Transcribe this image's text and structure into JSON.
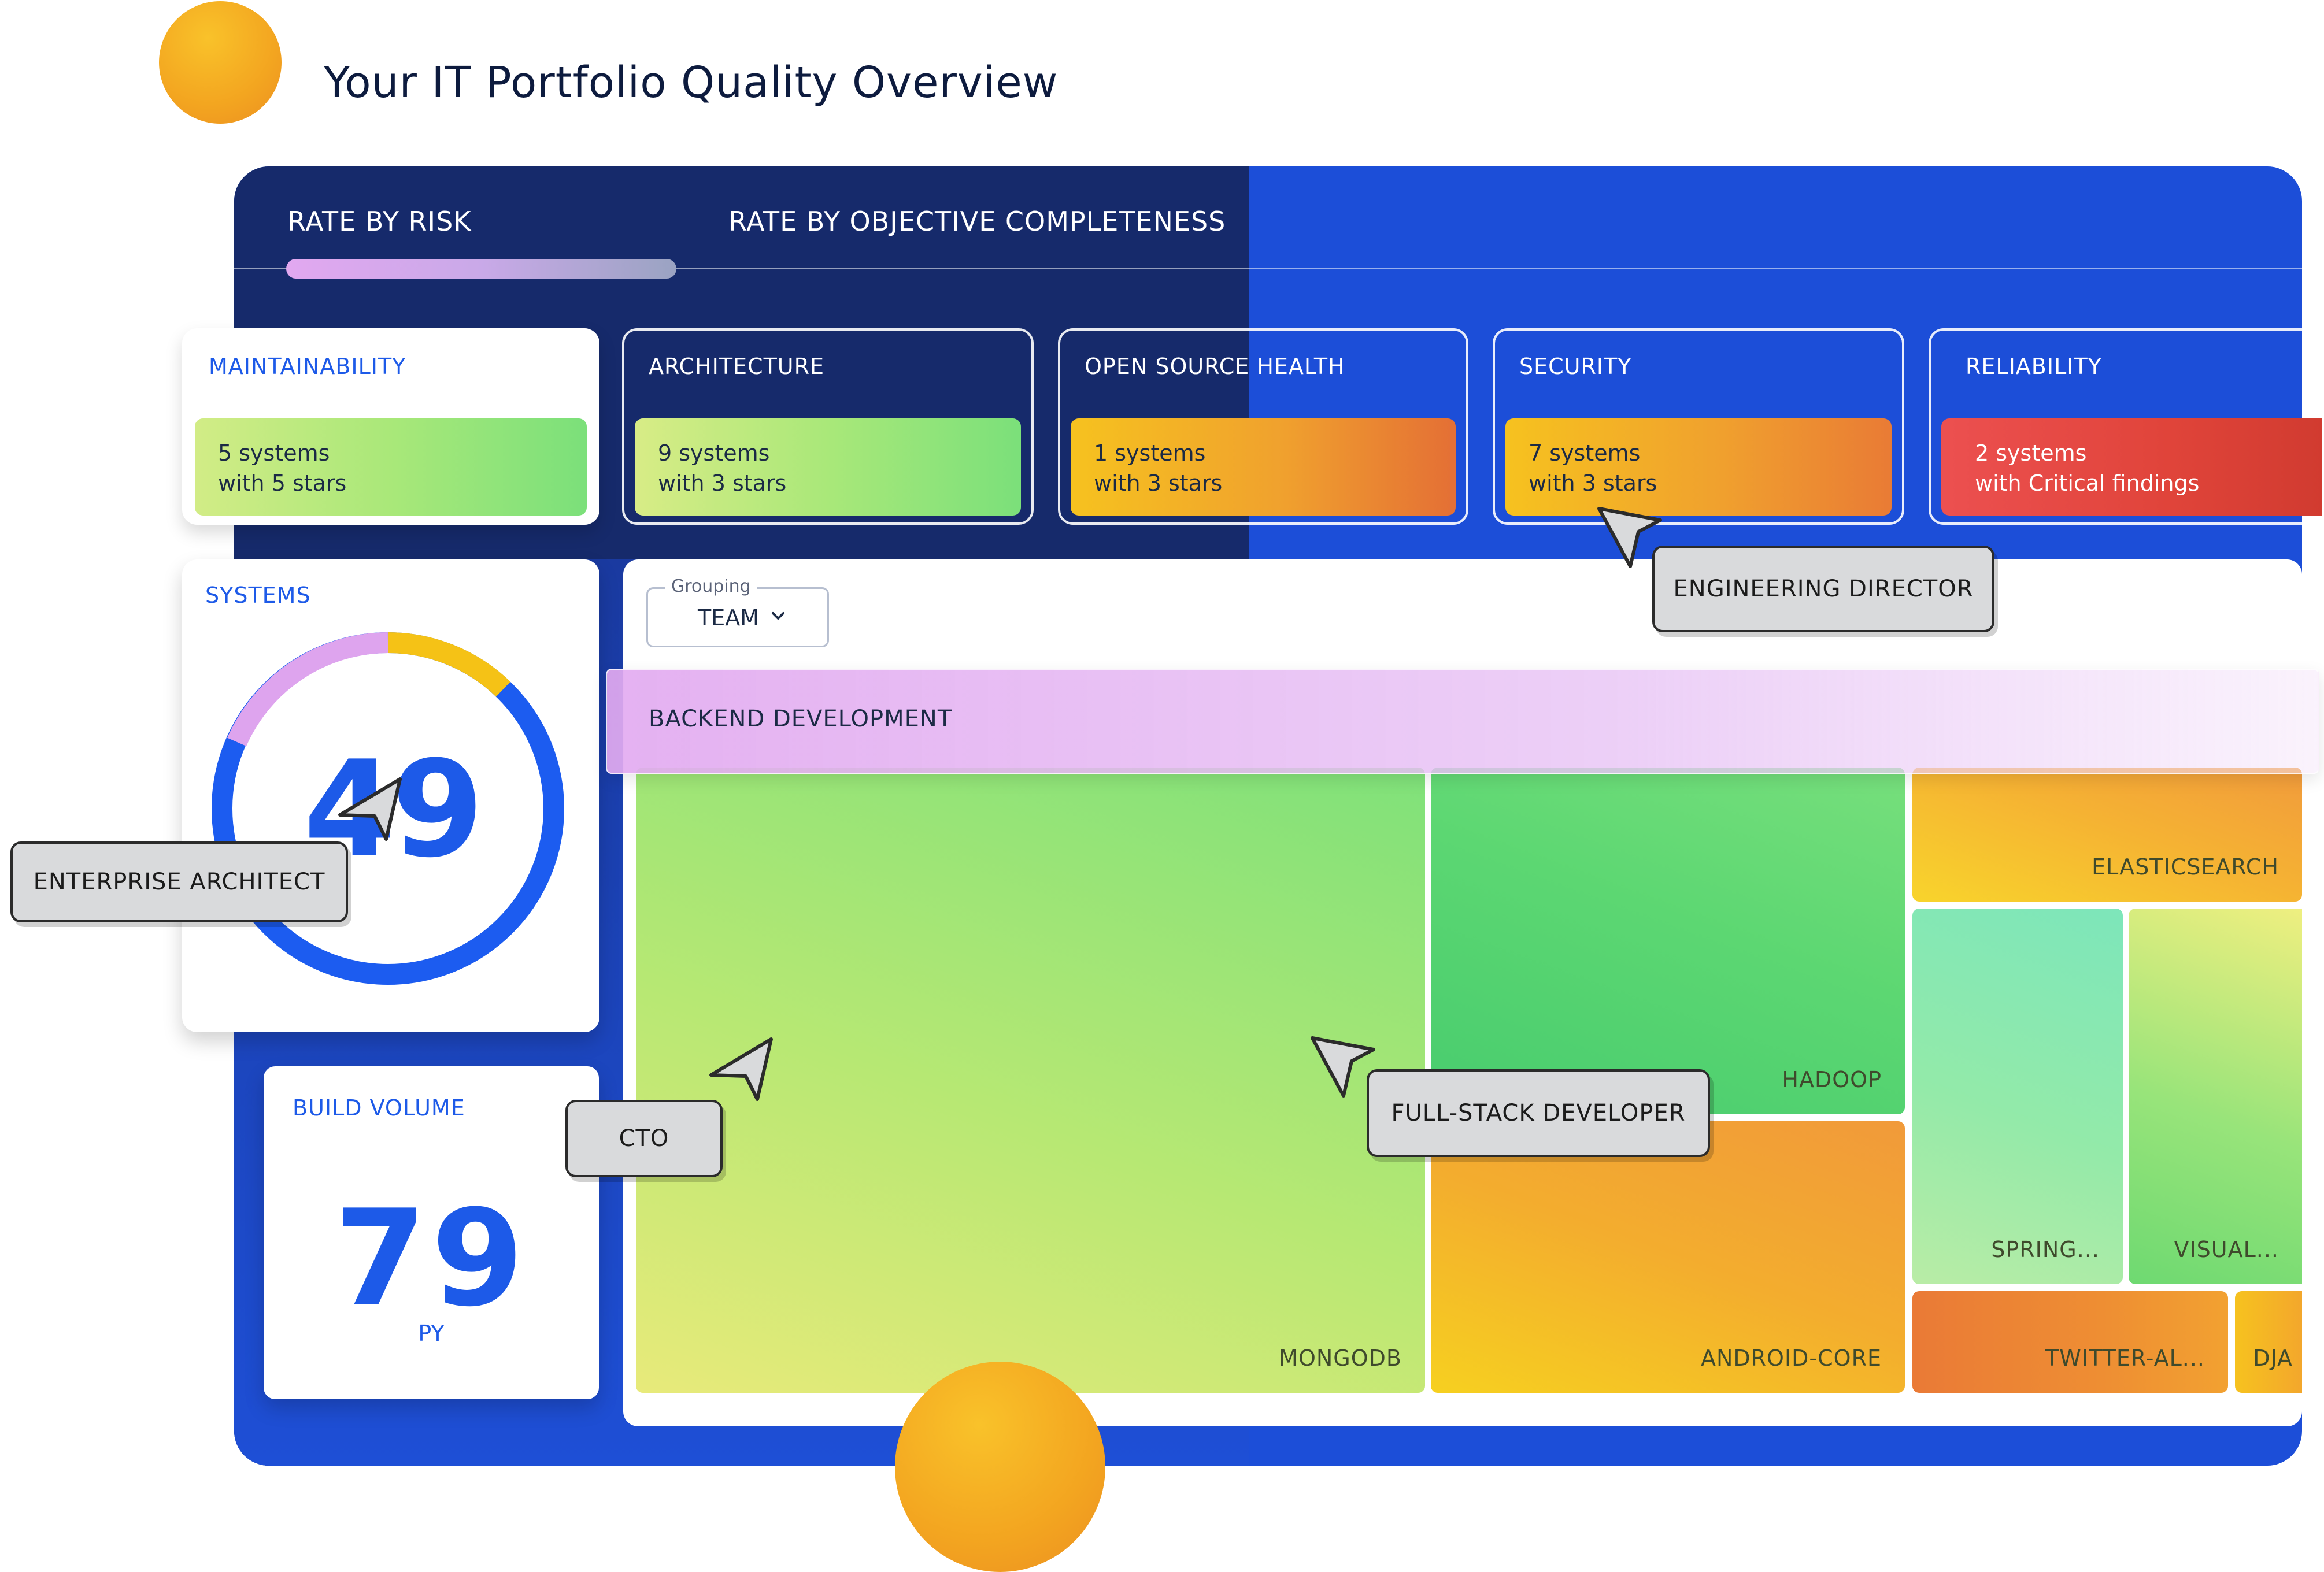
{
  "page": {
    "title": "Your IT Portfolio Quality Overview"
  },
  "tabs": [
    {
      "label": "RATE BY RISK",
      "active": true
    },
    {
      "label": "RATE BY OBJECTIVE COMPLETENESS",
      "active": false
    }
  ],
  "metrics": [
    {
      "title": "MAINTAINABILITY",
      "line1": "5 systems",
      "line2": "with 5 stars"
    },
    {
      "title": "ARCHITECTURE",
      "line1": "9 systems",
      "line2": "with 3 stars"
    },
    {
      "title": "OPEN SOURCE HEALTH",
      "line1": "1 systems",
      "line2": "with 3 stars"
    },
    {
      "title": "SECURITY",
      "line1": "7 systems",
      "line2": "with 3 stars"
    },
    {
      "title": "RELIABILITY",
      "line1": "2 systems",
      "line2": "with Critical findings"
    }
  ],
  "systems": {
    "label": "SYSTEMS",
    "value": "49"
  },
  "build_volume": {
    "label": "BUILD VOLUME",
    "value": "79",
    "unit": "PY"
  },
  "grouping": {
    "legend": "Grouping",
    "value": "TEAM"
  },
  "group_bar": {
    "label": "BACKEND DEVELOPMENT"
  },
  "treemap": {
    "cells": [
      "MONGODB",
      "HADOOP",
      "ANDROID-CORE",
      "ELASTICSEARCH",
      "SPRING...",
      "VISUAL...",
      "TWITTER-AL...",
      "DJA"
    ]
  },
  "personas": {
    "engineering_director": "ENGINEERING DIRECTOR",
    "enterprise_architect": "ENTERPRISE ARCHITECT",
    "cto": "CTO",
    "full_stack_developer": "FULL-STACK DEVELOPER"
  },
  "colors": {
    "brand_blue": "#1d5ae8",
    "navy": "#162a6b",
    "accent_orange": "#f3a520",
    "accent_pink": "#e2a8f0",
    "critical_red": "#e0443a",
    "good_green": "#7be07a"
  }
}
